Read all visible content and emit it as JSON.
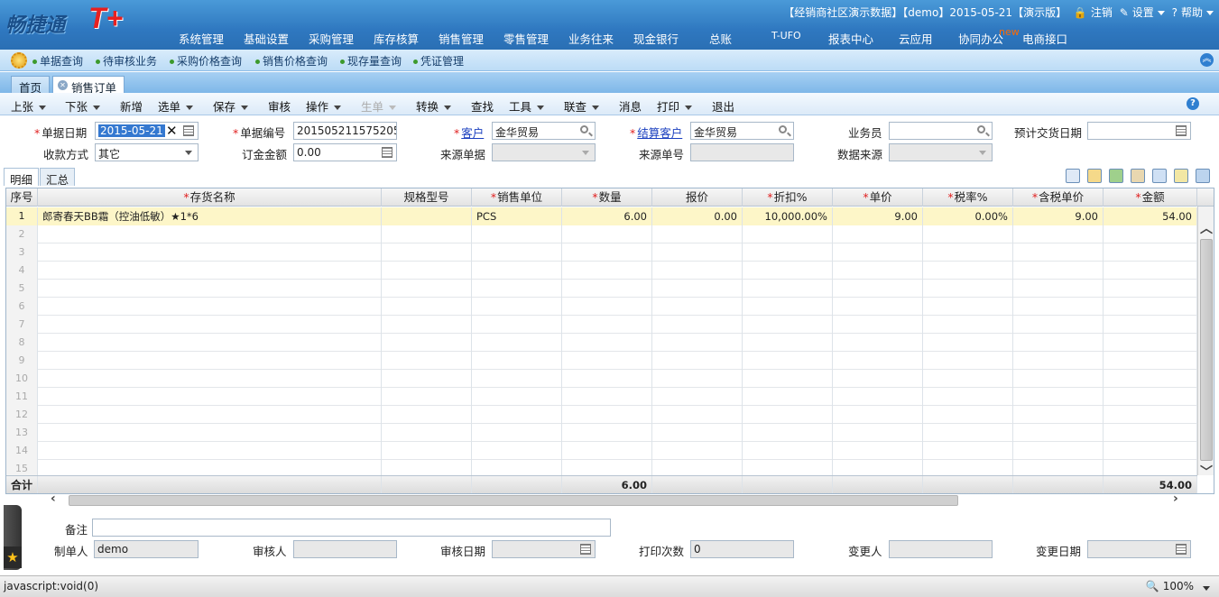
{
  "app": {
    "logo_text": "畅捷通",
    "logo_mark": "T+",
    "top_info": "【经销商社区演示数据】【demo】2015-05-21【演示版】",
    "logout": "注销",
    "settings": "设置",
    "help": "帮助"
  },
  "main_menu": [
    "系统管理",
    "基础设置",
    "采购管理",
    "库存核算",
    "销售管理",
    "零售管理",
    "业务往来",
    "现金银行",
    "总账",
    "T-UFO",
    "报表中心",
    "云应用",
    "协同办公",
    "电商接口"
  ],
  "new_badge": "new",
  "quick_links": [
    "单据查询",
    "待审核业务",
    "采购价格查询",
    "销售价格查询",
    "现存量查询",
    "凭证管理"
  ],
  "tabs": {
    "home": "首页",
    "active": "销售订单"
  },
  "toolbar": [
    {
      "label": "上张",
      "caret": true,
      "disabled": false
    },
    {
      "label": "下张",
      "caret": true,
      "disabled": false
    },
    {
      "label": "新增",
      "caret": false,
      "disabled": false
    },
    {
      "label": "选单",
      "caret": true,
      "disabled": false
    },
    {
      "label": "保存",
      "caret": true,
      "disabled": false
    },
    {
      "label": "审核",
      "caret": false,
      "disabled": false
    },
    {
      "label": "操作",
      "caret": true,
      "disabled": false
    },
    {
      "label": "生单",
      "caret": true,
      "disabled": true
    },
    {
      "label": "转换",
      "caret": true,
      "disabled": false
    },
    {
      "label": "查找",
      "caret": false,
      "disabled": false
    },
    {
      "label": "工具",
      "caret": true,
      "disabled": false
    },
    {
      "label": "联查",
      "caret": true,
      "disabled": false
    },
    {
      "label": "消息",
      "caret": false,
      "disabled": false
    },
    {
      "label": "打印",
      "caret": true,
      "disabled": false
    },
    {
      "label": "退出",
      "caret": false,
      "disabled": false
    }
  ],
  "form": {
    "doc_date_label": "单据日期",
    "doc_date": "2015-05-21",
    "doc_no_label": "单据编号",
    "doc_no": "201505211575205",
    "customer_label": "客户",
    "customer": "金华贸易",
    "settle_customer_label": "结算客户",
    "settle_customer": "金华贸易",
    "salesman_label": "业务员",
    "salesman": "",
    "expected_date_label": "预计交货日期",
    "expected_date": "",
    "payment_label": "收款方式",
    "payment": "其它",
    "deposit_label": "订金金额",
    "deposit": "0.00",
    "source_doc_label": "来源单据",
    "source_doc": "",
    "source_no_label": "来源单号",
    "source_no": "",
    "data_source_label": "数据来源",
    "data_source": ""
  },
  "detail_tabs": [
    "明细",
    "汇总"
  ],
  "grid": {
    "headers": [
      "序号",
      "存货名称",
      "规格型号",
      "销售单位",
      "数量",
      "报价",
      "折扣%",
      "单价",
      "税率%",
      "含税单价",
      "金额"
    ],
    "rows": [
      {
        "no": "1",
        "name": "郎寄春天BB霜（控油低敏）★1*6",
        "spec": "",
        "unit": "PCS",
        "qty": "6.00",
        "quote": "0.00",
        "discount": "10,000.00%",
        "price": "9.00",
        "tax": "0.00%",
        "taxprice": "9.00",
        "amount": "54.00"
      }
    ],
    "empty_rows": [
      "2",
      "3",
      "4",
      "5",
      "6",
      "7",
      "8",
      "9",
      "10",
      "11",
      "12",
      "13",
      "14",
      "15"
    ],
    "total_label": "合计",
    "total_qty": "6.00",
    "total_amount": "54.00"
  },
  "footer": {
    "remark_label": "备注",
    "remark": "",
    "maker_label": "制单人",
    "maker": "demo",
    "auditor_label": "审核人",
    "auditor": "",
    "audit_date_label": "审核日期",
    "audit_date": "",
    "print_count_label": "打印次数",
    "print_count": "0",
    "modifier_label": "变更人",
    "modifier": "",
    "modify_date_label": "变更日期",
    "modify_date": ""
  },
  "status": {
    "text": "javascript:void(0)",
    "zoom": "100%"
  }
}
